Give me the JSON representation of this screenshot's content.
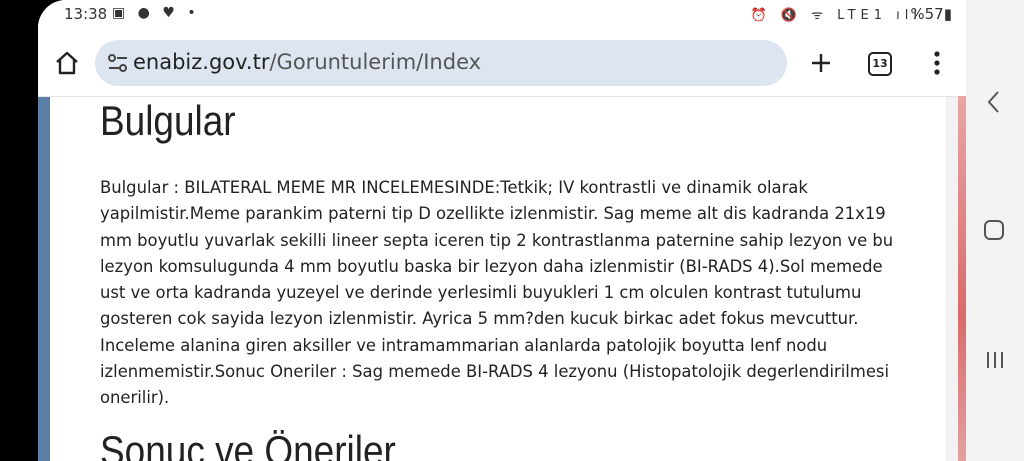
{
  "status": {
    "time": "13:38",
    "left_icons": "▣ ● ♥ •",
    "right_icons": "⏰ 🔇 ᯤ LTE1 ıll",
    "battery": "%57▮"
  },
  "browser": {
    "url_domain": "enabiz.gov.tr",
    "url_path": "/Goruntulerim/Index",
    "tab_count": "13"
  },
  "page": {
    "heading": "Bulgular",
    "body": "Bulgular : BILATERAL MEME MR INCELEMESINDE:Tetkik; IV kontrastli ve dinamik olarak yapilmistir.Meme parankim paterni tip D ozellikte izlenmistir. Sag meme alt dis kadranda 21x19 mm boyutlu yuvarlak sekilli lineer septa iceren tip 2 kontrastlanma paternine sahip lezyon ve bu lezyon komsulugunda 4 mm boyutlu baska bir lezyon daha izlenmistir (BI-RADS 4).Sol memede ust ve orta kadranda yuzeyel ve derinde yerlesimli buyukleri 1 cm olculen kontrast tutulumu gosteren cok sayida lezyon izlenmistir. Ayrica 5 mm?den kucuk birkac adet fokus mevcuttur. Inceleme alanina giren aksiller ve intramammarian alanlarda patolojik boyutta lenf nodu izlenmemistir.Sonuc Oneriler : Sag memede BI-RADS 4 lezyonu (Histopatolojik degerlendirilmesi onerilir).",
    "heading2": "Sonuc ve Öneriler"
  }
}
